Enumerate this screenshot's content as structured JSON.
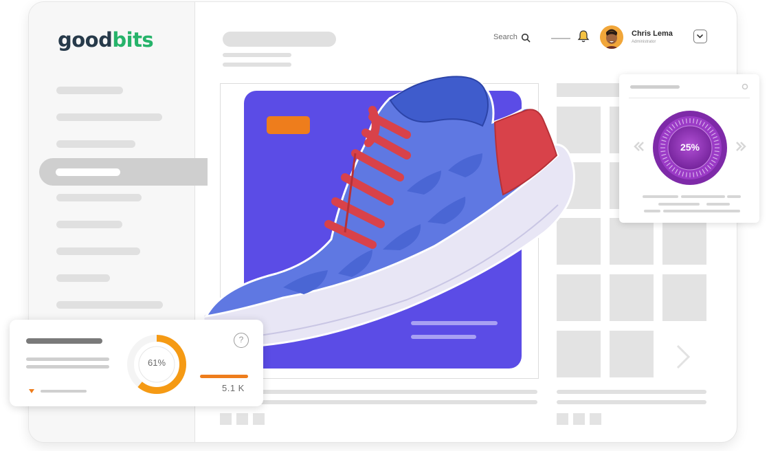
{
  "brand": {
    "logo_part1": "good",
    "logo_part2": "bits"
  },
  "header": {
    "search_label": "Search",
    "user_name": "Chris Lema",
    "user_role": "Administrator"
  },
  "stats_card": {
    "percent_label": "61%",
    "percent_value": 0.61,
    "size_label": "5.1 K"
  },
  "dial_card": {
    "percent_label": "25%",
    "percent_value": 0.25
  },
  "icons": [
    "search-icon",
    "bell-icon",
    "chevron-down-icon",
    "help-icon",
    "gear-icon",
    "chevron-left-icon",
    "chevron-right-icon"
  ],
  "colors": {
    "brand_dark": "#273a4a",
    "brand_green": "#26b36a",
    "hero_purple": "#5b4ce6",
    "accent_orange": "#ee7d1c",
    "dial_purple": "#8a2bb0",
    "shoe_blue": "#5570e0",
    "lace_red": "#d8424a"
  }
}
